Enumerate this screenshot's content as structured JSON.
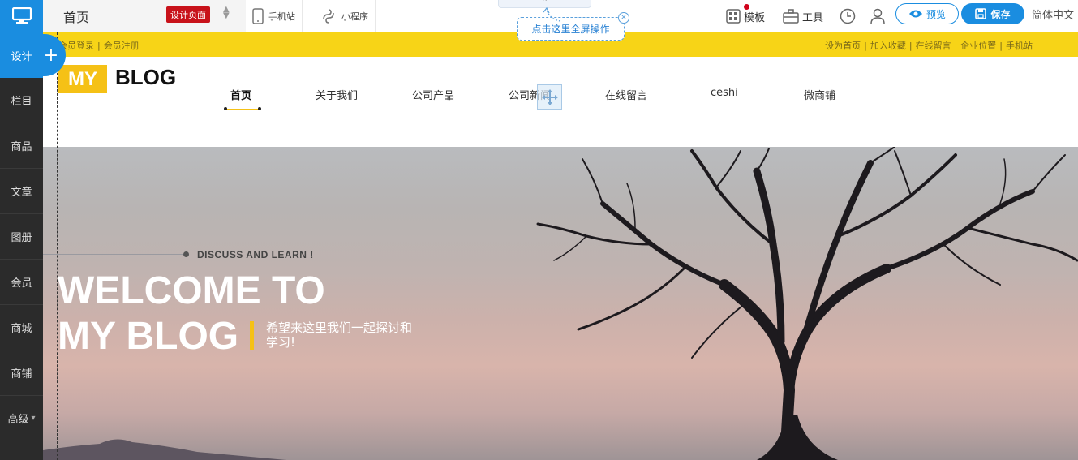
{
  "sidebar": {
    "logo_icon": "monitor-icon",
    "design_label": "设计",
    "add_label": "+",
    "items": [
      {
        "label": "栏目"
      },
      {
        "label": "商品"
      },
      {
        "label": "文章"
      },
      {
        "label": "图册"
      },
      {
        "label": "会员"
      },
      {
        "label": "商城"
      },
      {
        "label": "商铺"
      },
      {
        "label": "高级"
      }
    ],
    "more_arrow": "▾"
  },
  "toolbar": {
    "page_title": "首页",
    "design_badge": "设计页面",
    "mobile_label": "手机站",
    "miniapp_label": "小程序",
    "collapse_glyph": "⌃",
    "fullscreen_tip": "点击这里全屏操作",
    "tip_close": "×",
    "template_label": "模板",
    "tools_label": "工具",
    "preview_label": "预览",
    "save_label": "保存",
    "language": "简体中文"
  },
  "site": {
    "topbar": {
      "left_links": [
        "会员登录",
        "会员注册"
      ],
      "right_links": [
        "设为首页",
        "加入收藏",
        "在线留言",
        "企业位置",
        "手机站"
      ]
    },
    "logo": {
      "my": "MY",
      "blog": "BLOG"
    },
    "nav": [
      "首页",
      "关于我们",
      "公司产品",
      "公司新闻",
      "在线留言",
      "ceshi",
      "微商铺"
    ],
    "banner": {
      "tag": "DISCUSS AND LEARN !",
      "title_line1": "WELCOME TO",
      "title_line2": "MY BLOG",
      "desc": "希望来这里我们一起探讨和学习!"
    }
  },
  "colors": {
    "accent_blue": "#1a8de0",
    "sidebar_bg": "#2b2b2b",
    "topbar_yellow": "#f7d417",
    "logo_yellow": "#f5c116",
    "badge_red": "#c8121a"
  }
}
